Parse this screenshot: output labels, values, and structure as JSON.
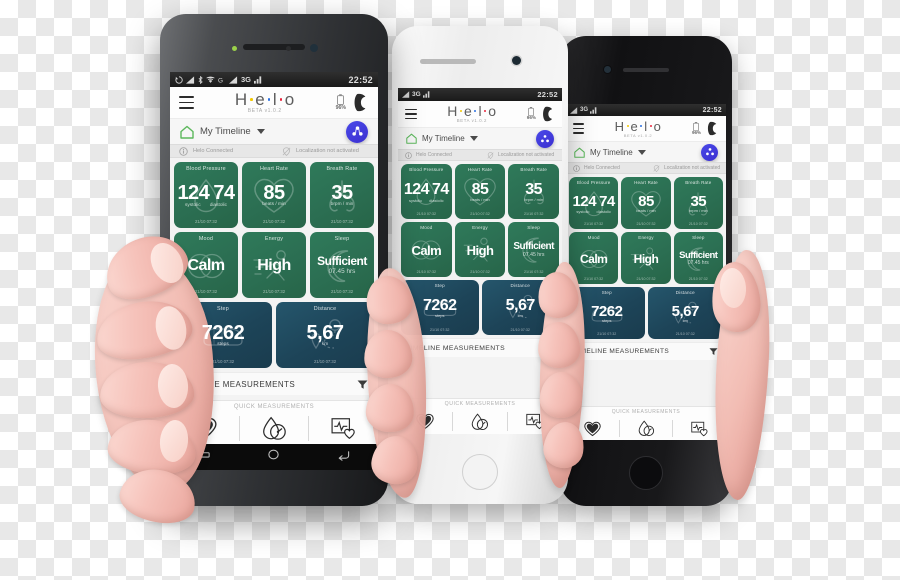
{
  "scene": {
    "background": "transparent-checkerboard",
    "phones": [
      {
        "id": "phone-back-right",
        "body_color": "#161618",
        "style": "black-iphone"
      },
      {
        "id": "phone-middle",
        "body_color": "#f3f3f3",
        "style": "white-iphone"
      },
      {
        "id": "phone-front-left",
        "body_color": "#303235",
        "style": "grey-android"
      }
    ]
  },
  "status_bar": {
    "time": "22:52",
    "network": "3G",
    "icons": [
      "sync-icon",
      "signal-icon",
      "bluetooth-icon",
      "wifi-icon",
      "sim-icon",
      "signal-bars-icon"
    ]
  },
  "app_bar": {
    "menu_icon": "hamburger-icon",
    "logo_text": "H e l o",
    "logo_letters": [
      "H",
      "e",
      "l",
      "o"
    ],
    "logo_tagline": "BETA v1.0.2",
    "logo_dot_colors": [
      "#7a7a7a",
      "#f2c800",
      "#2b6fe0",
      "#e8233c"
    ],
    "battery_percent": "96%",
    "battery_icon": "battery-icon",
    "band_icon": "wristband-icon"
  },
  "timeline_bar": {
    "home_icon": "home-icon",
    "home_icon_color": "#5cb85c",
    "label": "My Timeline",
    "dropdown_icon": "chevron-down-icon",
    "fab_icon": "share-icon",
    "fab_color": "#3f33d6"
  },
  "connection_bar": {
    "items": [
      {
        "icon": "info-icon",
        "label": "Helo Connected"
      },
      {
        "icon": "location-off-icon",
        "label": "Localization not activated"
      }
    ]
  },
  "cards": [
    {
      "title": "Blood Pressure",
      "systolic": "124",
      "diastolic": "74",
      "unit_left": "systolic",
      "unit_right": "diastolic",
      "timestamp": "21/10 07:32",
      "color": "green",
      "watermark_icon": "blood-drop-icon"
    },
    {
      "title": "Heart Rate",
      "value": "85",
      "unit": "beats / min",
      "timestamp": "21/10 07:32",
      "color": "green",
      "watermark_icon": "heart-icon"
    },
    {
      "title": "Breath Rate",
      "value": "35",
      "unit": "brpm / min",
      "timestamp": "21/10 07:32",
      "color": "green",
      "watermark_icon": "lungs-icon"
    },
    {
      "title": "Mood",
      "value": "Calm",
      "unit": "",
      "timestamp": "21/10 07:32",
      "color": "green",
      "watermark_icon": "mood-circles-icon"
    },
    {
      "title": "Energy",
      "value": "High",
      "unit": "",
      "timestamp": "21/10 07:32",
      "color": "green",
      "watermark_icon": "runner-icon"
    },
    {
      "title": "Sleep",
      "value": "Sufficient",
      "unit": "07.45 hrs",
      "timestamp": "21/10 07:32",
      "color": "green",
      "watermark_icon": "moon-icon"
    },
    {
      "title": "Step",
      "value": "7262",
      "unit": "steps",
      "timestamp": "21/10 07:32",
      "color": "blue",
      "watermark_icon": "shoe-icon"
    },
    {
      "title": "Distance",
      "value": "5,67",
      "unit": "km",
      "timestamp": "21/10 07:32",
      "color": "blue",
      "watermark_icon": "route-pin-icon"
    }
  ],
  "timeline_measurements": {
    "label": "TIMELINE MEASUREMENTS",
    "filter_icon": "filter-icon"
  },
  "quick_measurements": {
    "label": "QUICK MEASUREMENTS",
    "buttons": [
      {
        "icon": "heart-filled-icon",
        "name": "heart-rate"
      },
      {
        "icon": "blood-pressure-gauge-icon",
        "name": "blood-pressure"
      },
      {
        "icon": "ecg-heart-icon",
        "name": "ecg"
      }
    ]
  },
  "nav_bar": {
    "buttons": [
      {
        "icon": "recents-icon"
      },
      {
        "icon": "home-nav-icon"
      },
      {
        "icon": "back-icon"
      }
    ]
  },
  "colors": {
    "green_card": "#2b6e52",
    "blue_card": "#1d4458",
    "accent_blue": "#3f33d6",
    "home_green": "#5cb85c",
    "status_bar": "#1a1a1a"
  }
}
